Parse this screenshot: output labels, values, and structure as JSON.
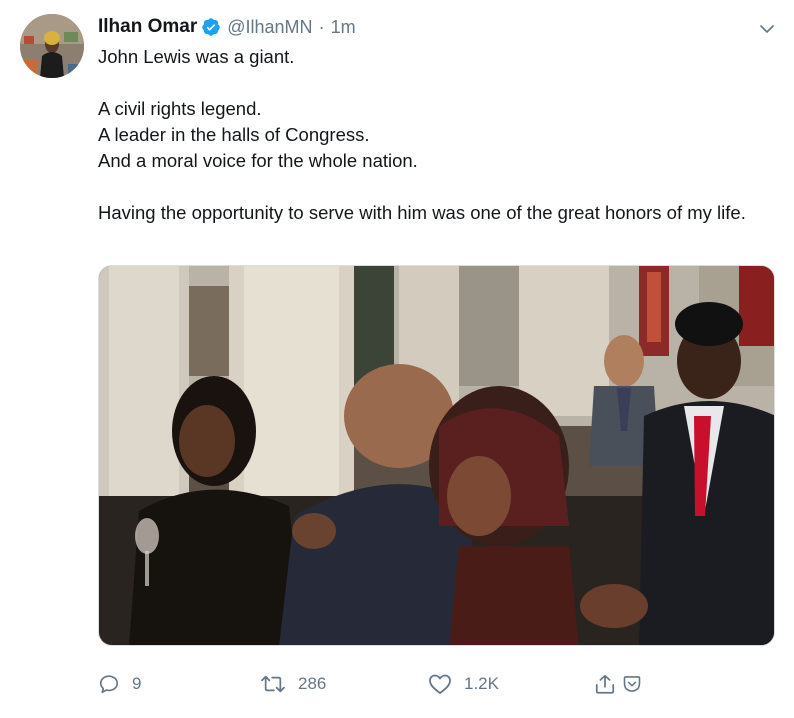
{
  "tweet": {
    "author": {
      "display_name": "Ilhan Omar",
      "handle": "@IlhanMN",
      "verified": true
    },
    "time": "1m",
    "separator": "·",
    "lines": [
      "John Lewis was a giant.",
      "",
      "A civil rights legend.",
      "A leader in the halls of Congress.",
      "And a moral voice for the whole nation.",
      "",
      "Having the opportunity to serve with him was one of the great honors of my life."
    ],
    "actions": {
      "reply_count": "9",
      "retweet_count": "286",
      "like_count": "1.2K"
    }
  },
  "colors": {
    "accent": "#1da1f2",
    "muted": "#657786",
    "text": "#14171a",
    "retweet_red_tie": "#c8102e"
  },
  "icons": [
    "verified-badge-icon",
    "chevron-down-icon",
    "reply-icon",
    "retweet-icon",
    "like-icon",
    "share-icon",
    "pocket-icon"
  ]
}
